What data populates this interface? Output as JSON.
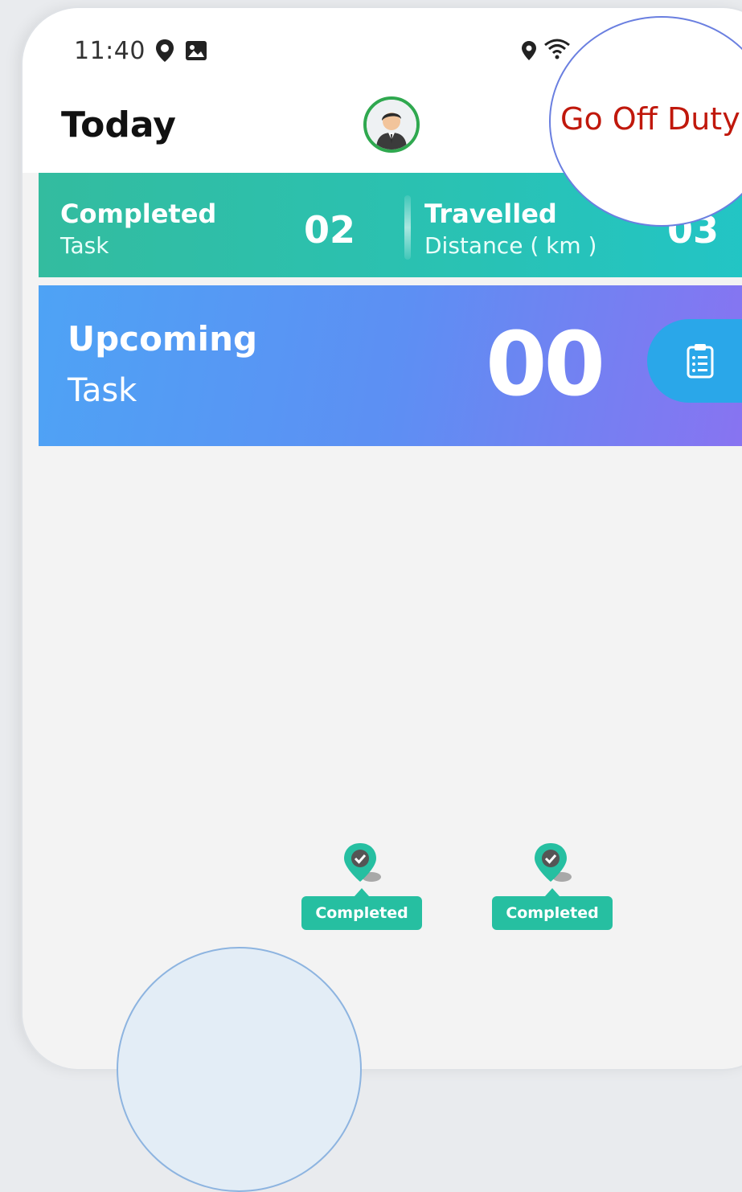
{
  "status_bar": {
    "time": "11:40",
    "icons": [
      "location-icon",
      "image-icon",
      "location-icon",
      "wifi-icon"
    ]
  },
  "header": {
    "title": "Today",
    "avatar": "avatar",
    "off_duty_label": "Go Off Duty"
  },
  "stats": {
    "completed": {
      "label_bold": "Completed",
      "label": "Task",
      "value": "02"
    },
    "travelled": {
      "label_bold": "Travelled",
      "label": "Distance ( km )",
      "value": "03"
    }
  },
  "upcoming": {
    "title": "Upcoming",
    "subtitle": "Task",
    "count": "00",
    "button_icon": "clipboard-list-icon"
  },
  "map": {
    "markers": [
      {
        "label": "Completed",
        "icon": "check-pin-icon"
      },
      {
        "label": "Completed",
        "icon": "check-pin-icon"
      }
    ]
  },
  "colors": {
    "stats_bg": "#2fbfa8",
    "upcoming_start": "#4ea3f5",
    "upcoming_end": "#8a72f1",
    "off_duty_text": "#c0180c",
    "avatar_ring": "#2fa84f",
    "marker": "#26bfa1"
  }
}
